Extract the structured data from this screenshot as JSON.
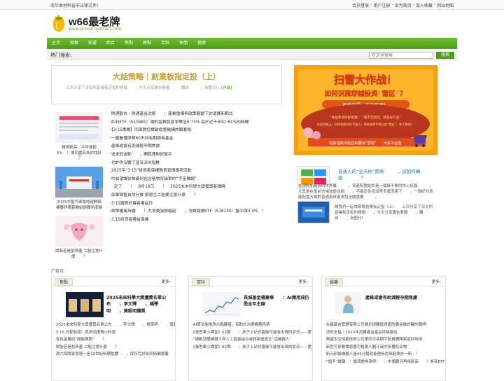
{
  "topbar": {
    "notice": "南华本材料益非法律文件!",
    "links": [
      "会员登录",
      "-",
      "用户注册",
      "-",
      "设为首页",
      "-",
      "加入收藏",
      "-",
      "网站地图"
    ]
  },
  "header": {
    "title": "w66最老牌",
    "url": "www.prima-contract.com"
  },
  "nav": [
    "主页",
    "频集",
    "知道",
    "综合",
    "焦點",
    "熱點",
    "百科",
    "休閒",
    "搜索"
  ],
  "search": {
    "label": "熱门搜索:",
    "placeholder": "在这里搜索",
    "button": "搜索"
  },
  "feature": {
    "title": "大話策略｜創業板指定投（上）",
    "desc": "上次分享了深交所創業板定投的視頻　　，今天分享廣告看圖　　　轉自　　　；自图兄!",
    "more": "...[详细]"
  },
  "banner": {
    "line1": "扫雪大作战！",
    "line2": "如何识雅穿越投资“雪区”？",
    "tag": "拒绝踩雷，条则实用！",
    "sub1": "“收益率高得好奇葩”、“股市无风险，就是好产品”",
    "sub2": "在投资路上，风险相关知识不能少，那些投资中常见的“雪区”，你了解吗？",
    "bottom": "投资理财风险控制要有\"雪地\"　　大家不应忽"
  },
  "thumbs": [
    {
      "caption": "韓債新高…今年漲超5%　！債到處高為你找好了"
    },
    {
      "caption": "2025中國汽車場地越野錦標賽評備賞開始調賽熱度歸"
    },
    {
      "caption": "鬧新若是割資產 二胎注意什麼　　？"
    }
  ],
  "mainlist": [
    "·財通觀市｜財通基金沈梨　　：產業重構與政策驅動下的消費新範式",
    "·紅利ETF（510880）標的指數股息率攀至6.73% 高於近十年91.61%的時間",
    "·【3·15專欄】同面教您識破假冒機構詐騙套路",
    "·一圖看懂摩根60天持有期債券基金",
    "·產維或會有助減輕孕期焦慮",
    "·追求低波動　　，開我理財好幫手",
    "·也許你沒聽了溫深300指數",
    "·2025年“3·15”投資者保護教育宣傳專項活動",
    "·吟舶望讓徐帕攝到包含植物背緣索的“宇宙橢網”",
    "　定了　　！　8月16日　　！　2025未來科學大獎獲獎者揭曉",
    "·如果調整自然分推 那麼生二胎要注意什麼　　？",
    "·3·15國際消費者權益日",
    "·政策暖風持續　　！大消費強勢崛起　　，消費龍頭ETF（516130）盤中漲3.4%　！",
    "·3.15投資者權益保護"
  ],
  "sidebox": {
    "headline": "普通人的“全天候”策略　　　，該如何構建　　　　？",
    "text1": "在理財和投資的世界裏　　　，資產配置始終是一個繞不開的核心話題　　　。尤其是在當前市場波動加劇　　，不確定性增加等多重因素下　　，一個好的資產配置方案對普通投資者來說至關重要　　　。",
    "text2": "讓我們一起來聊聊創業板定投（上）　　上次分享了深交所創業板定投的視頻　　，今天分享廣告看圖　　，轉自　　：自图兄！"
  },
  "adlabel": "广告位",
  "panels": [
    {
      "tab": "焦點",
      "more": "更多›",
      "title": "2025未來科學大獎獲獎名單公布　　，李文輝　　、楊學明　　、莫毅明獲獎",
      "items": [
        "·2025未來科學大獎獲獎名單公布　　，李文輝　　，楊學明　　、莫毅明獲獎",
        "·3.15 五勤有錢！我資須證情小科普",
        "·有色金屬迎“超級周期”　　？",
        "·鬧胎若是割資產 二胎注意什麼　　？",
        "·洞穴探險家發現一座19世紀時期骷髏　　，保存完好如同時間膠囊"
      ]
    },
    {
      "tab": "百科",
      "more": "更多›",
      "title": "長城基金楊建華　　：AI應用成仍是全年主線",
      "items": [
        "·AI算法能推測大腦腺瘤，有助於治療癲癇疾病",
        "·《張思果小課堂》62期　　：孩子上幼兒園後可能會出現的狀況——愛生病了",
        "·“細胞活體機器人與人工智能結合或將製造真正“活機器人”",
        "·《張思果小課堂》62期　　：孩子上幼兒園後可能會出現的狀況——愛生病了"
      ]
    },
    {
      "tab": "娛樂",
      "more": "更多›",
      "title": "產維或會有助減輕孕期焦慮",
      "items": [
        "·永贏基金管理有限公司關於提醒投資者防範金融詐騙的聲明",
        "·消安全倡｜2025年消費者金產品評級報告",
        "·美國太空探索技術公司第四次長期宇航員團隊將返回地球",
        "·新型可穿戴傳感器可檢測人體汗液中多種化合物",
        "·新元研製機器人僅45分鐘就能便時尚球鞋換外一新　！",
        "·“旗手”燿聲　！旗濟證券漲停　　，中國銀河再探新高　　！券商ETF（512000）攔漲4%　　，一季度業績有望"
      ]
    }
  ]
}
